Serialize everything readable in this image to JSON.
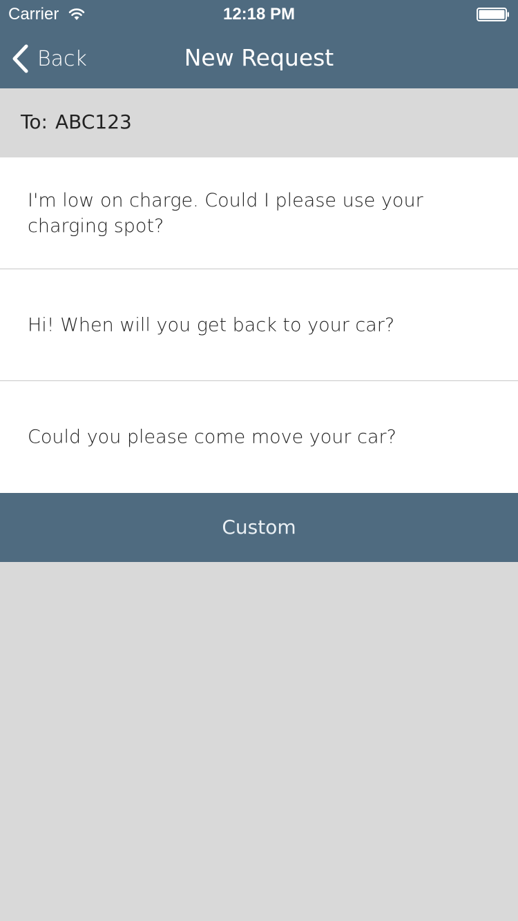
{
  "status_bar": {
    "carrier": "Carrier",
    "time": "12:18 PM",
    "wifi_icon": "wifi-icon",
    "battery_icon": "battery-full-icon"
  },
  "nav": {
    "back_label": "Back",
    "back_icon": "chevron-left-icon",
    "title": "New Request"
  },
  "recipient": {
    "label": "To:",
    "value": "ABC123"
  },
  "messages": [
    {
      "text": "I'm low on charge. Could I please use your charging spot?"
    },
    {
      "text": "Hi! When will you get back to your car?"
    },
    {
      "text": "Could you please come move your car?"
    }
  ],
  "custom_button": {
    "label": "Custom"
  },
  "colors": {
    "header_bg": "#4f6b80",
    "page_bg": "#d9d9d9",
    "list_bg": "#ffffff",
    "divider": "#c8c8c8"
  }
}
